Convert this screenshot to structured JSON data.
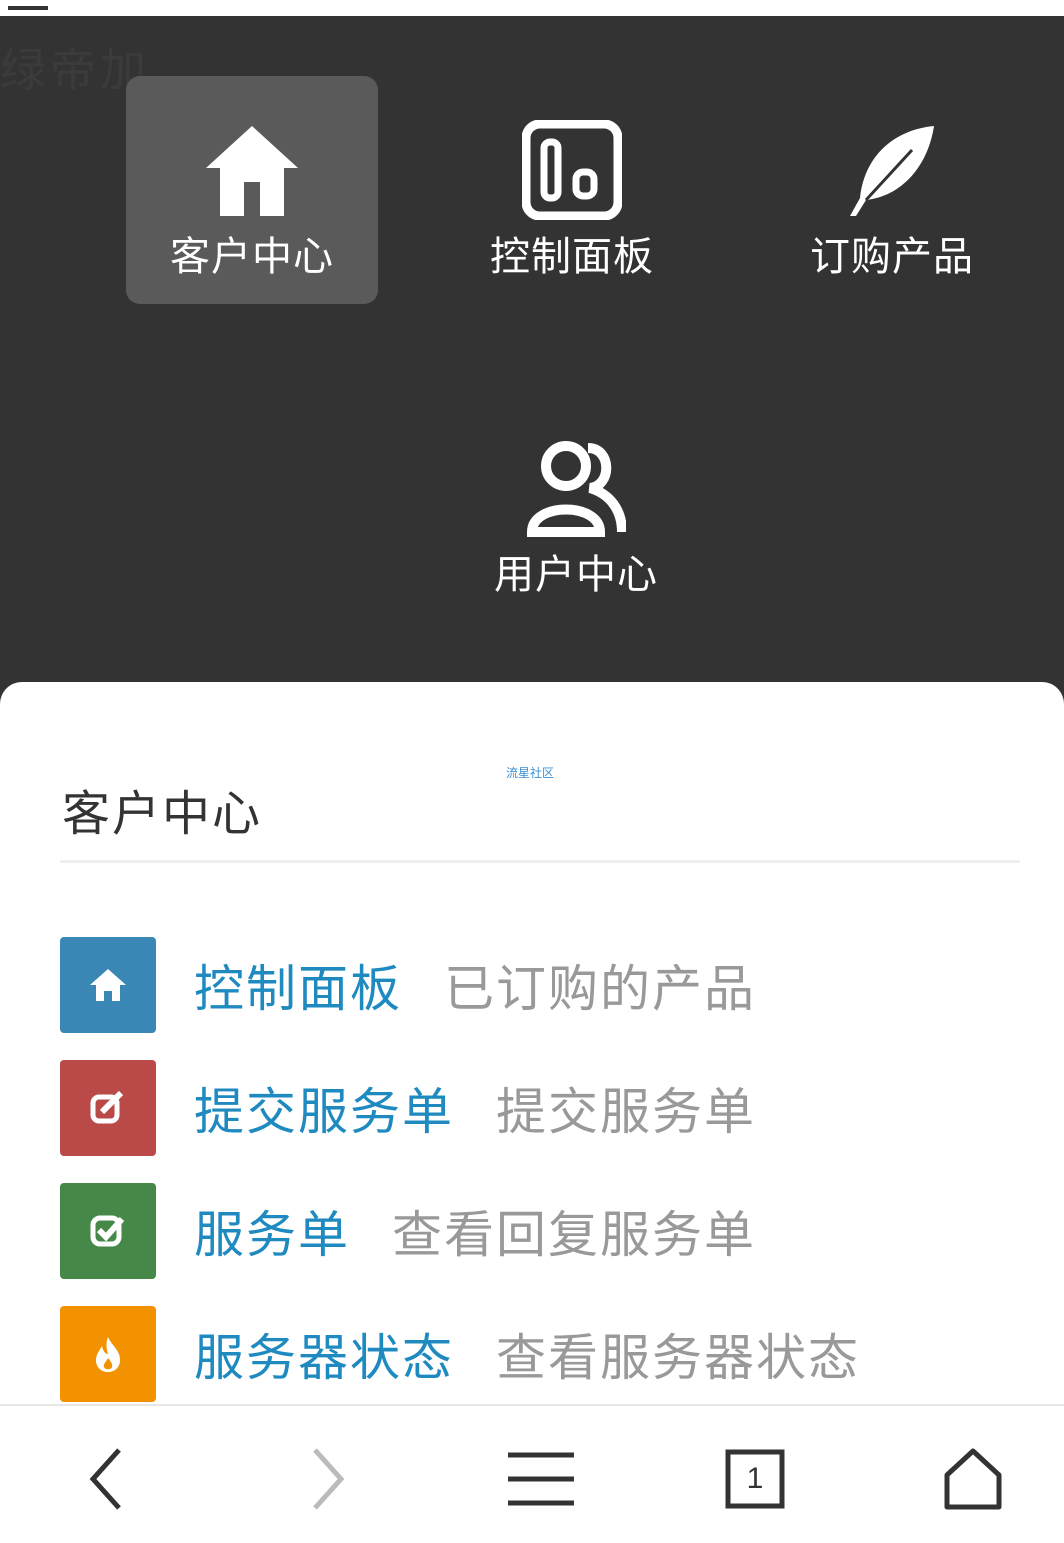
{
  "topbar": {
    "ghost_text": "绿帝加"
  },
  "menu": {
    "items": [
      {
        "label": "客户中心",
        "icon": "home-icon",
        "active": true
      },
      {
        "label": "控制面板",
        "icon": "dashboard-icon",
        "active": false
      },
      {
        "label": "订购产品",
        "icon": "feather-icon",
        "active": false
      },
      {
        "label": "用户中心",
        "icon": "users-icon",
        "active": false
      }
    ]
  },
  "content": {
    "section_title": "客户中心",
    "watermark": "流星社区",
    "rows": [
      {
        "title": "控制面板",
        "desc": "已订购的产品",
        "icon": "home-icon",
        "color": "#3a87b5"
      },
      {
        "title": "提交服务单",
        "desc": "提交服务单",
        "icon": "edit-icon",
        "color": "#b94a48"
      },
      {
        "title": "服务单",
        "desc": "查看回复服务单",
        "icon": "check-icon",
        "color": "#468847"
      },
      {
        "title": "服务器状态",
        "desc": "查看服务器状态",
        "icon": "fire-icon",
        "color": "#f39200"
      }
    ]
  },
  "browser": {
    "tab_count": "1"
  },
  "colors": {
    "panel_bg": "#333333",
    "active_tile": "#5a5a5a",
    "link": "#1f8ac0",
    "muted": "#999999"
  }
}
